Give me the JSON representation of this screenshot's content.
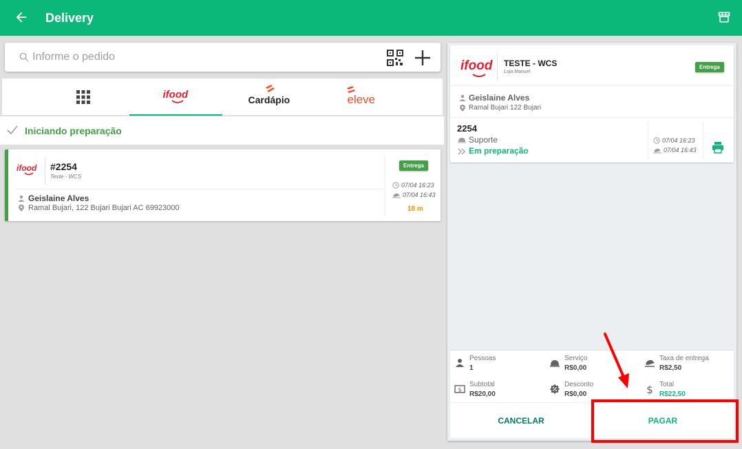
{
  "appbar": {
    "title": "Delivery"
  },
  "search": {
    "placeholder": "Informe o pedido"
  },
  "tabs": [
    {
      "id": "all",
      "icon": "grid-icon"
    },
    {
      "id": "ifood",
      "label": "ifood"
    },
    {
      "id": "cardapio",
      "label": "Cardápio"
    },
    {
      "id": "eleve",
      "label": "eleve"
    }
  ],
  "status": {
    "label": "Iniciando preparação"
  },
  "order_card": {
    "logo": "ifood",
    "number": "#2254",
    "store": "Teste - WCS",
    "customer": "Geislaine Alves",
    "address": "Ramal Bujari, 122 Bujari Bujari AC 69923000",
    "badge": "Entrega",
    "time_created": "07/04 16:23",
    "time_delivery": "07/04 16:43",
    "elapsed": "18 m"
  },
  "detail": {
    "logo": "ifood",
    "store_name": "TESTE - WCS",
    "store_sub": "Loja Manuel",
    "badge": "Entrega",
    "customer": "Geislaine Alves",
    "address": "Ramal Bujari 122  Bujari",
    "order_number": "2254",
    "channel": "Suporte",
    "status": "Em preparação",
    "time_created": "07/04 16:23",
    "time_delivery": "07/04 16:43"
  },
  "totals": {
    "pessoas": {
      "label": "Pessoas",
      "value": "1"
    },
    "servico": {
      "label": "Serviço",
      "value": "R$0,00"
    },
    "taxa": {
      "label": "Taxa de entrega",
      "value": "R$2,50"
    },
    "subtotal": {
      "label": "Subtotal",
      "value": "R$20,00"
    },
    "desconto": {
      "label": "Desconto",
      "value": "R$0,00"
    },
    "total": {
      "label": "Total",
      "value": "R$22,50"
    }
  },
  "actions": {
    "cancel": "CANCELAR",
    "pay": "PAGAR"
  },
  "colors": {
    "primary": "#0cb77a",
    "ifood": "#ea1d2c",
    "highlight": "#ff0000"
  }
}
